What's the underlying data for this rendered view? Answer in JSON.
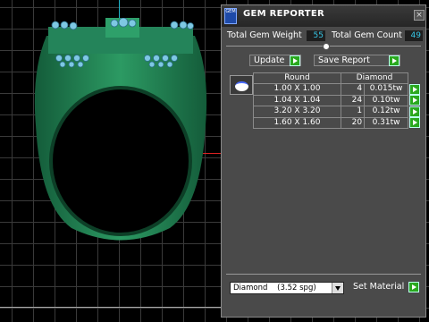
{
  "panel": {
    "title": "GEM REPORTER",
    "icon_text": "GEM",
    "close_glyph": "×",
    "total_weight_label": "Total Gem Weight",
    "total_weight_value": "55",
    "total_count_label": "Total Gem Count",
    "total_count_value": "49",
    "update_label": "Update",
    "save_report_label": "Save Report",
    "table": {
      "headers": [
        "Round",
        "Diamond"
      ],
      "rows": [
        {
          "size": "1.00 X 1.00",
          "count": "4",
          "weight": "0.015tw"
        },
        {
          "size": "1.04 X 1.04",
          "count": "24",
          "weight": "0.10tw"
        },
        {
          "size": "3.20 X 3.20",
          "count": "1",
          "weight": "0.12tw"
        },
        {
          "size": "1.60 X 1.60",
          "count": "20",
          "weight": "0.31tw"
        }
      ]
    },
    "material_value": "Diamond    (3.52 spg)",
    "set_material_label": "Set Material"
  },
  "colors": {
    "ring": "#1f7a4f",
    "gems": "#7ec8e3",
    "panel_bg": "#4a4a4a",
    "value_text": "#38c8e8",
    "go_button": "#2aa81e"
  }
}
